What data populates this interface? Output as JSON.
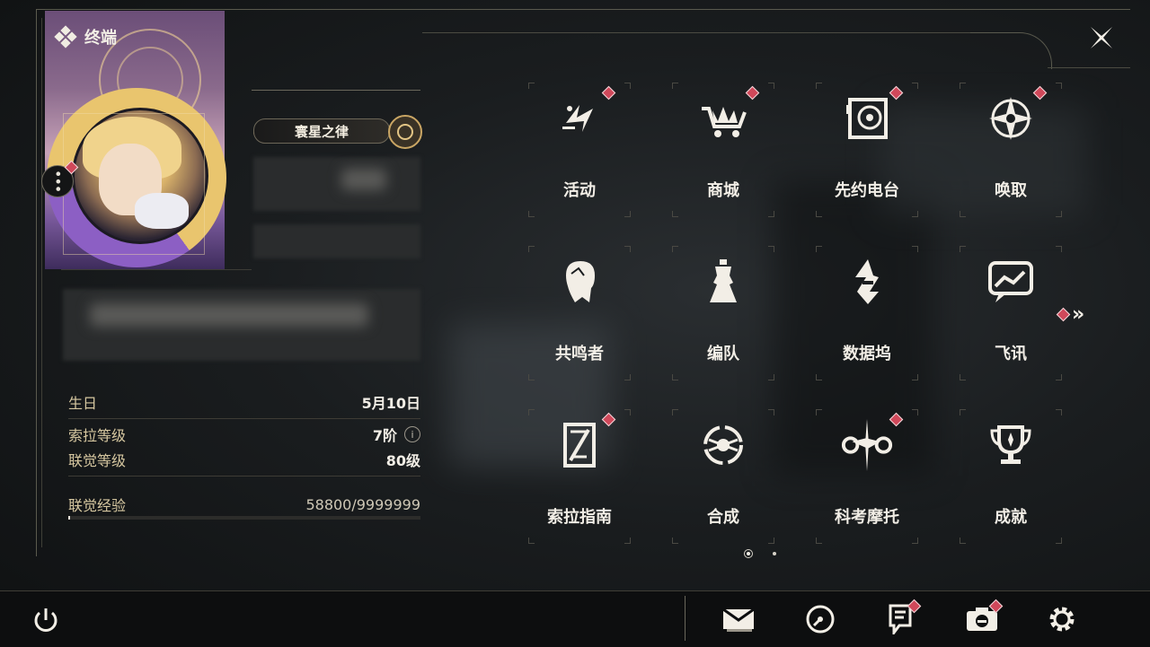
{
  "header": {
    "title": "终端"
  },
  "profile": {
    "title_plate": "寰星之律",
    "info": {
      "birthday_label": "生日",
      "birthday_value": "5月10日",
      "sola_level_label": "索拉等级",
      "sola_level_value": "7阶",
      "info_glyph": "i",
      "union_level_label": "联觉等级",
      "union_level_value": "80级",
      "union_exp_label": "联觉经验",
      "union_exp_value": "58800/9999999",
      "union_exp_progress": 0.0059
    }
  },
  "menu": {
    "items": [
      {
        "label": "活动",
        "icon": "events-icon",
        "badge": true
      },
      {
        "label": "商城",
        "icon": "shop-cart-icon",
        "badge": true
      },
      {
        "label": "先约电台",
        "icon": "radio-icon",
        "badge": true
      },
      {
        "label": "唤取",
        "icon": "convene-icon",
        "badge": true
      },
      {
        "label": "共鸣者",
        "icon": "resonator-icon",
        "badge": false
      },
      {
        "label": "编队",
        "icon": "team-icon",
        "badge": false
      },
      {
        "label": "数据坞",
        "icon": "data-bank-icon",
        "badge": false
      },
      {
        "label": "飞讯",
        "icon": "messages-icon",
        "badge": false
      },
      {
        "label": "索拉指南",
        "icon": "guide-icon",
        "badge": true
      },
      {
        "label": "合成",
        "icon": "synthesis-icon",
        "badge": false
      },
      {
        "label": "科考摩托",
        "icon": "motorcycle-icon",
        "badge": true
      },
      {
        "label": "成就",
        "icon": "trophy-icon",
        "badge": false
      }
    ],
    "next_glyph": "»",
    "pages": {
      "current": 1,
      "total": 2
    }
  },
  "bottombar": {
    "icons": [
      "power-icon",
      "mail-icon",
      "clock-icon",
      "notice-icon",
      "camera-icon",
      "settings-icon"
    ]
  },
  "colors": {
    "accent_gold": "#caa664",
    "badge_red": "#d0485a",
    "label_gold": "#d6c7a0",
    "text_light": "#f2eee6"
  }
}
